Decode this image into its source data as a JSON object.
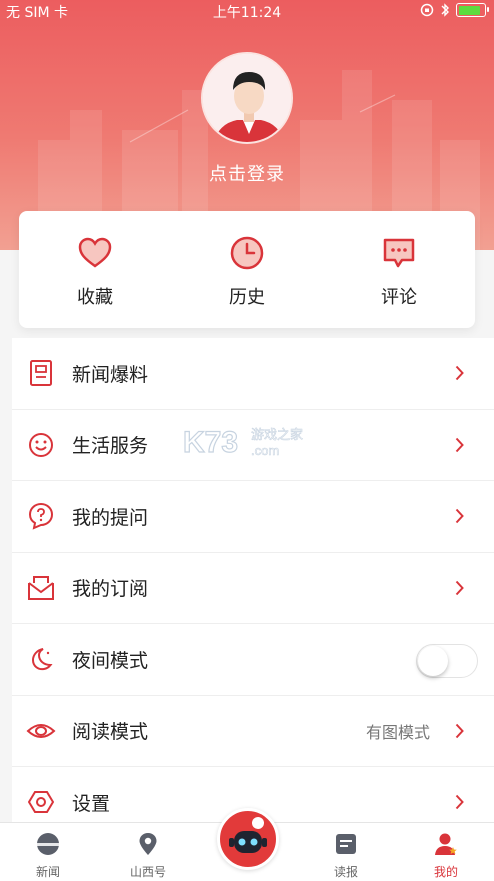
{
  "status_bar": {
    "carrier": "无 SIM 卡",
    "time": "上午11:24"
  },
  "profile": {
    "login_label": "点击登录"
  },
  "quick_actions": [
    {
      "label": "收藏",
      "icon": "heart-icon"
    },
    {
      "label": "历史",
      "icon": "clock-icon"
    },
    {
      "label": "评论",
      "icon": "comment-icon"
    }
  ],
  "menu": [
    {
      "label": "新闻爆料",
      "icon": "news-tip-icon"
    },
    {
      "label": "生活服务",
      "icon": "smile-icon"
    },
    {
      "label": "我的提问",
      "icon": "question-icon"
    },
    {
      "label": "我的订阅",
      "icon": "inbox-icon"
    },
    {
      "label": "夜间模式",
      "icon": "moon-icon",
      "toggle": false
    },
    {
      "label": "阅读模式",
      "icon": "eye-icon",
      "value": "有图模式"
    },
    {
      "label": "设置",
      "icon": "settings-icon"
    }
  ],
  "watermark": {
    "brand": "K73",
    "tag": "游戏之家",
    "domain": ".com"
  },
  "tabbar": [
    {
      "label": "新闻",
      "icon": "news-icon"
    },
    {
      "label": "山西号",
      "icon": "location-icon"
    },
    {
      "label": "读报",
      "icon": "newspaper-icon"
    },
    {
      "label": "我的",
      "icon": "user-icon",
      "active": true
    }
  ],
  "colors": {
    "accent": "#d9343a",
    "hero": "#ec5d5f"
  }
}
